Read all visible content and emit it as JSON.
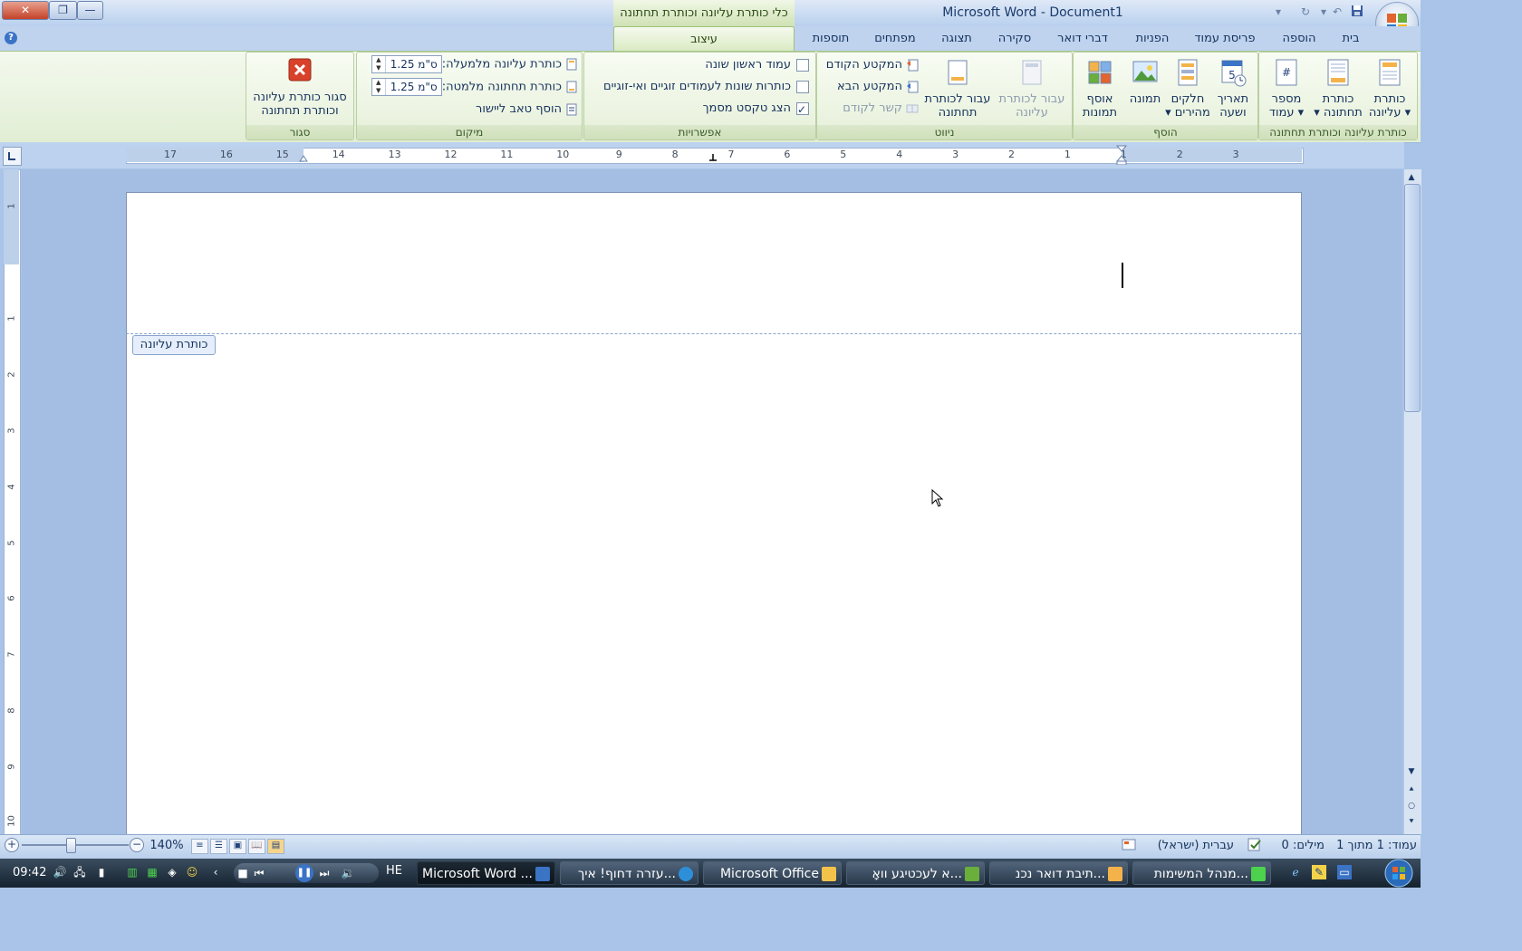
{
  "window": {
    "app_title": "Microsoft Word - Document1",
    "context_title": "כלי כותרת עליונה וכותרת תחתונה",
    "close_label": "✕",
    "restore_label": "❐",
    "minimize_label": "—"
  },
  "tabs": {
    "home": "בית",
    "insert": "הוספה",
    "page_layout": "פריסת עמוד",
    "references": "הפניות",
    "mailings": "דברי דואר",
    "review": "סקירה",
    "view": "תצוגה",
    "developer": "מפתחים",
    "addins": "תוספות",
    "design": "עיצוב"
  },
  "ribbon": {
    "hf_group": {
      "label": "כותרת עליונה וכותרת תחתונה",
      "header_l1": "כותרת",
      "header_l2": "עליונה ▾",
      "footer_l1": "כותרת",
      "footer_l2": "▾ תחתונה",
      "pagenum_l1": "מספר",
      "pagenum_l2": "עמוד ▾"
    },
    "insert_group": {
      "label": "הוסף",
      "datetime_l1": "תאריך",
      "datetime_l2": "ושעה",
      "quickparts_l1": "חלקים",
      "quickparts_l2": "▾ מהירים",
      "picture": "תמונה",
      "clipart_l1": "אוסף",
      "clipart_l2": "תמונות"
    },
    "nav_group": {
      "label": "ניווט",
      "goto_header_l1": "עבור לכותרת",
      "goto_header_l2": "עליונה",
      "goto_footer_l1": "עבור לכותרת",
      "goto_footer_l2": "תחתונה",
      "previous_section": "המקטע הקודם",
      "next_section": "המקטע הבא",
      "link_previous": "קשר לקודם"
    },
    "options_group": {
      "label": "אפשרויות",
      "different_first": "עמוד ראשון שונה",
      "different_odd_even": "כותרות שונות לעמודים זוגיים ואי-זוגיים",
      "show_doc_text": "הצג טקסט מסמך"
    },
    "position_group": {
      "label": "מיקום",
      "header_from_top": "כותרת עליונה מלמעלה:",
      "header_from_top_value": "1.25 ס\"מ",
      "footer_from_bottom": "כותרת תחתונה מלמטה:",
      "footer_from_bottom_value": "1.25 ס\"מ",
      "insert_align_tab": "הוסף טאב ליישור"
    },
    "close_group": {
      "label": "סגור",
      "close_l1": "סגור כותרת עליונה",
      "close_l2": "וכותרת תחתונה"
    }
  },
  "ruler": {
    "h_numbers": [
      "17",
      "16",
      "15",
      "14",
      "13",
      "12",
      "11",
      "10",
      "9",
      "8",
      "7",
      "6",
      "5",
      "4",
      "3",
      "2",
      "1",
      "1",
      "2",
      "3"
    ],
    "v_numbers": [
      "1",
      "1",
      "2",
      "3",
      "4",
      "5",
      "6",
      "7",
      "8",
      "9",
      "10"
    ]
  },
  "document": {
    "header_tag": "כותרת עליונה"
  },
  "statusbar": {
    "page": "עמוד: 1 מתוך 1",
    "words": "מילים: 0",
    "language": "עברית (ישראל)",
    "zoom": "140%"
  },
  "taskbar": {
    "clock": "09:42",
    "lang": "HE",
    "items": [
      "Microsoft Word ...",
      "עזרה דחוף! איך...",
      "Microsoft Office",
      "א לעכטיגע וואָ...",
      "תיבת דואר נכנ...",
      "מנהל המשימות..."
    ]
  },
  "colors": {
    "ribbon_green": "#e2eed4",
    "blue_bg": "#a9c4e8",
    "taskbar": "#15222f"
  }
}
